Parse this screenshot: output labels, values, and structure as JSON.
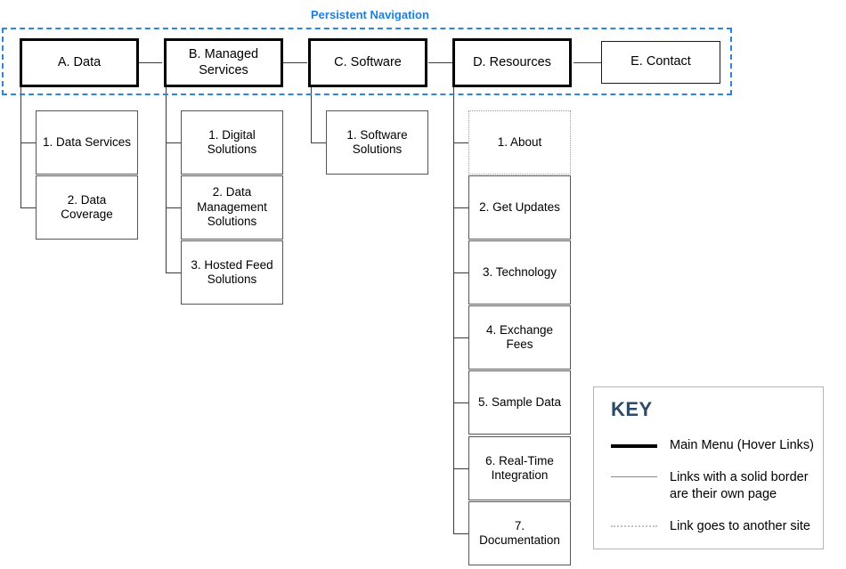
{
  "diagram": {
    "type": "sitemap",
    "persistent_nav": {
      "label": "Persistent Navigation"
    },
    "top_level": [
      {
        "id": "A",
        "label": "A. Data",
        "style": "main-menu"
      },
      {
        "id": "B",
        "label": "B. Managed\nServices",
        "style": "main-menu"
      },
      {
        "id": "C",
        "label": "C. Software",
        "style": "main-menu"
      },
      {
        "id": "D",
        "label": "D. Resources",
        "style": "main-menu"
      },
      {
        "id": "E",
        "label": "E. Contact",
        "style": "own-page"
      }
    ],
    "children": {
      "A": [
        {
          "label": "1. Data Services",
          "style": "own-page"
        },
        {
          "label": "2. Data Coverage",
          "style": "own-page"
        }
      ],
      "B": [
        {
          "label": "1. Digital\nSolutions",
          "style": "own-page"
        },
        {
          "label": "2. Data\nManagement\nSolutions",
          "style": "own-page"
        },
        {
          "label": "3. Hosted Feed\nSolutions",
          "style": "own-page"
        }
      ],
      "C": [
        {
          "label": "1. Software\nSolutions",
          "style": "own-page"
        }
      ],
      "D": [
        {
          "label": "1. About",
          "style": "external"
        },
        {
          "label": "2. Get Updates",
          "style": "own-page"
        },
        {
          "label": "3. Technology",
          "style": "own-page"
        },
        {
          "label": "4. Exchange Fees",
          "style": "own-page"
        },
        {
          "label": "5. Sample Data",
          "style": "own-page"
        },
        {
          "label": "6. Real-Time\nIntegration",
          "style": "own-page"
        },
        {
          "label": "7.\nDocumentation",
          "style": "own-page"
        }
      ],
      "E": []
    }
  },
  "legend": {
    "title": "KEY",
    "items": [
      {
        "swatch": "thick-line",
        "text": "Main Menu (Hover Links)"
      },
      {
        "swatch": "thin-line",
        "text": "Links with a solid border\nare their own page"
      },
      {
        "swatch": "dotted-line",
        "text": "Link goes to another site"
      }
    ]
  },
  "colors": {
    "persistent_nav_border": "#2a86e0",
    "persistent_nav_label": "#1f7fe0",
    "legend_title": "#2d4a66",
    "box_border_main": "#000000",
    "box_border_page": "#555555",
    "box_border_external": "#9a9a9a",
    "connector": "#3b3b3b",
    "background": "#ffffff"
  }
}
